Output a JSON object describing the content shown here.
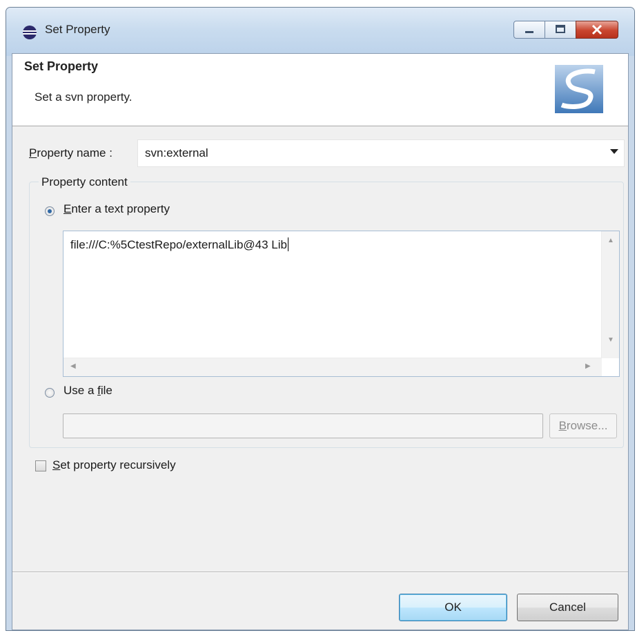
{
  "window": {
    "title": "Set Property",
    "controls": {
      "minimize": "minimize",
      "maximize": "maximize",
      "close": "close"
    }
  },
  "header": {
    "title": "Set Property",
    "description": "Set a svn property."
  },
  "property_name": {
    "label_mnemonic": "P",
    "label_rest": "roperty name :",
    "value": "svn:external"
  },
  "property_content": {
    "legend": "Property content",
    "text_option": {
      "mnemonic": "E",
      "label_rest": "nter a text property",
      "selected": true
    },
    "text_value": "file:///C:%5CtestRepo/externalLib@43 Lib",
    "file_option": {
      "label_before": "Use a ",
      "mnemonic": "f",
      "label_after": "ile",
      "selected": false
    },
    "file_value": "",
    "browse": {
      "mnemonic": "B",
      "label_rest": "rowse...",
      "enabled": false
    }
  },
  "recursive": {
    "mnemonic": "S",
    "label_rest": "et property recursively",
    "checked": false
  },
  "buttons": {
    "ok": "OK",
    "cancel": "Cancel"
  },
  "icons": {
    "title_icon": "eclipse-icon",
    "logo": "subversive-logo-icon",
    "accent": "#3c7fb1",
    "close_red": "#c9452f"
  }
}
